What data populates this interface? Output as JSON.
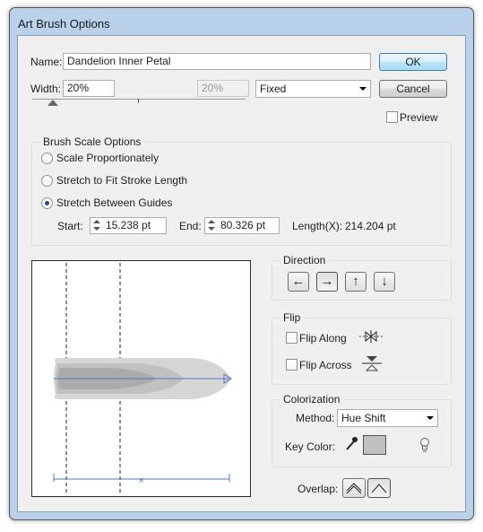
{
  "dialog": {
    "title": "Art Brush Options"
  },
  "name": {
    "label": "Name:",
    "value": "Dandelion Inner Petal"
  },
  "width": {
    "label": "Width:",
    "value": "20%",
    "secondary_value": "20%",
    "mode": "Fixed",
    "slider_fraction": 0.15
  },
  "buttons": {
    "ok": "OK",
    "cancel": "Cancel"
  },
  "preview": {
    "label": "Preview",
    "checked": false
  },
  "brush_scale": {
    "title": "Brush Scale Options",
    "options": [
      "Scale Proportionately",
      "Stretch to Fit Stroke Length",
      "Stretch Between Guides"
    ],
    "selected": "Stretch Between Guides",
    "start_label": "Start:",
    "start_value": "15.238 pt",
    "end_label": "End:",
    "end_value": "80.326 pt",
    "length_label": "Length(X):",
    "length_value": "214.204 pt"
  },
  "direction": {
    "title": "Direction",
    "arrows": [
      "←",
      "→",
      "↑",
      "↓"
    ],
    "selected": "→"
  },
  "flip": {
    "title": "Flip",
    "along_label": "Flip Along",
    "across_label": "Flip Across",
    "along_checked": false,
    "across_checked": false
  },
  "colorization": {
    "title": "Colorization",
    "method_label": "Method:",
    "method_value": "Hue Shift",
    "key_color_label": "Key Color:",
    "key_color": "#c0c0c0"
  },
  "overlap": {
    "label": "Overlap:"
  },
  "colors": {
    "accent": "#3c7fb1",
    "guide": "#4a78c8"
  }
}
